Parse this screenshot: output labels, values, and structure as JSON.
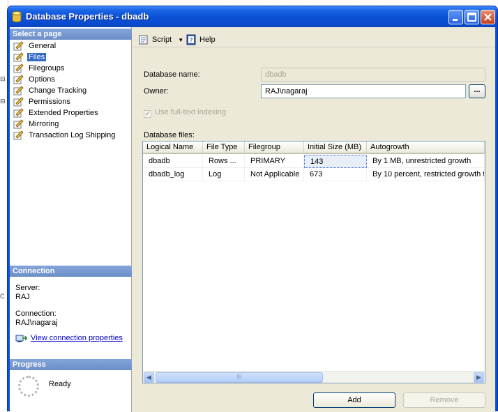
{
  "window": {
    "title": "Database Properties - dbadb"
  },
  "left_pane": {
    "select_page_header": "Select a page",
    "pages": [
      {
        "label": "General",
        "name": "general"
      },
      {
        "label": "Files",
        "name": "files",
        "selected": true
      },
      {
        "label": "Filegroups",
        "name": "filegroups"
      },
      {
        "label": "Options",
        "name": "options"
      },
      {
        "label": "Change Tracking",
        "name": "change-tracking"
      },
      {
        "label": "Permissions",
        "name": "permissions"
      },
      {
        "label": "Extended Properties",
        "name": "extended-properties"
      },
      {
        "label": "Mirroring",
        "name": "mirroring"
      },
      {
        "label": "Transaction Log Shipping",
        "name": "transaction-log-shipping"
      }
    ],
    "connection_header": "Connection",
    "server_label": "Server:",
    "server_value": "RAJ",
    "connection_label": "Connection:",
    "connection_value": "RAJ\\nagaraj",
    "view_connection_link": "View connection properties",
    "progress_header": "Progress",
    "progress_status": "Ready"
  },
  "toolbar": {
    "script_label": "Script",
    "help_label": "Help"
  },
  "form": {
    "database_name_label": "Database name:",
    "database_name_value": "dbadb",
    "owner_label": "Owner:",
    "owner_value": "RAJ\\nagaraj",
    "ellipsis_label": "...",
    "fulltext_label": "Use full-text indexing",
    "database_files_label": "Database files:"
  },
  "grid": {
    "columns": [
      "Logical Name",
      "File Type",
      "Filegroup",
      "Initial Size (MB)",
      "Autogrowth"
    ],
    "rows": [
      [
        "dbadb",
        "Rows ...",
        "PRIMARY",
        "143",
        "By 1 MB, unrestricted growth"
      ],
      [
        "dbadb_log",
        "Log",
        "Not Applicable",
        "673",
        "By 10 percent, restricted growth t..."
      ]
    ],
    "scroll_thumb": "III"
  },
  "buttons": {
    "add_label": "Add",
    "remove_label": "Remove"
  },
  "colors": {
    "titlebar": "#0a52d6",
    "selection": "#316ac5",
    "section_header": "#7b9ad0",
    "client_bg": "#ece9d8"
  }
}
